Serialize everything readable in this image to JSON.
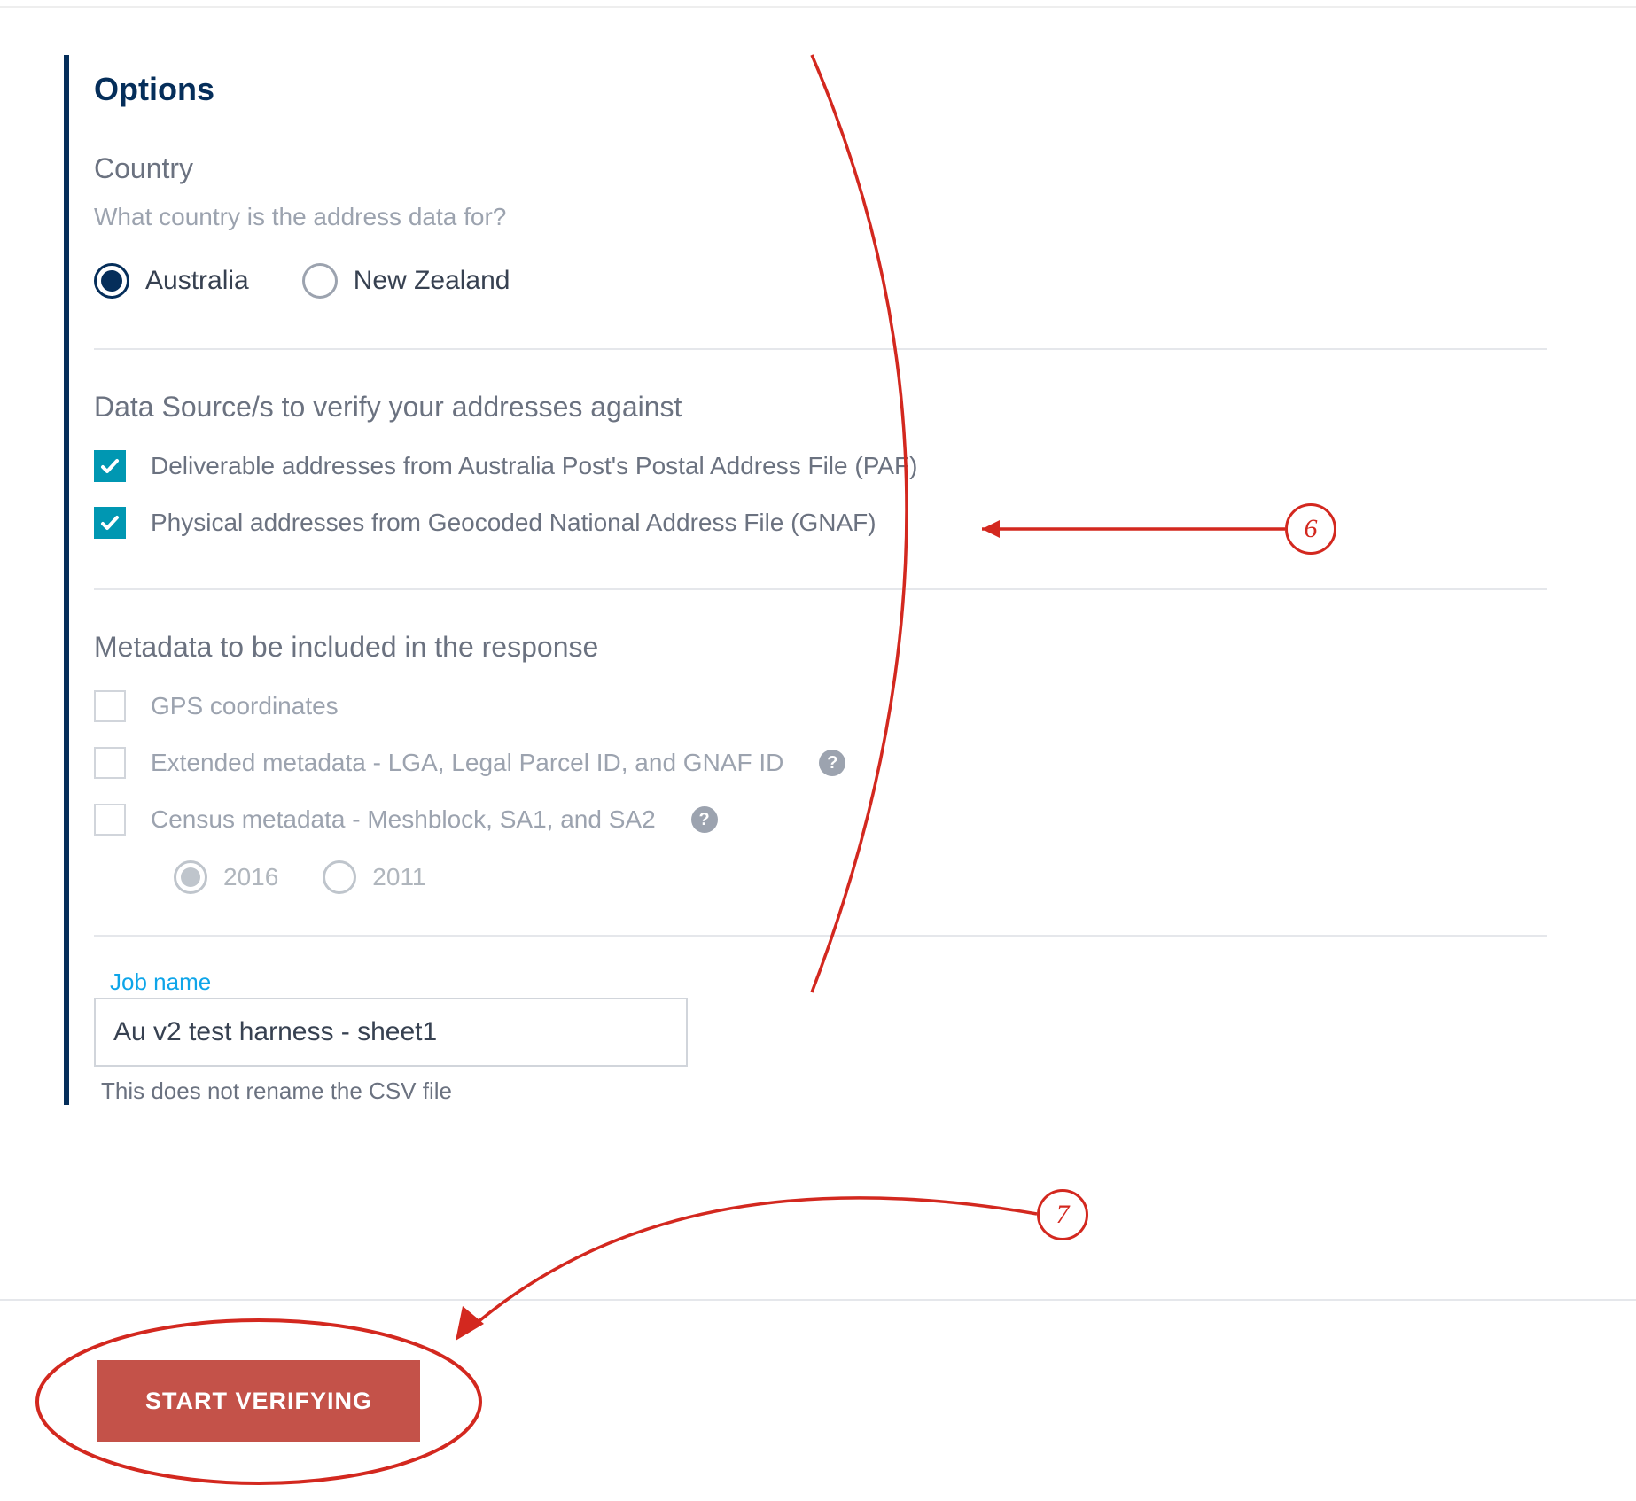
{
  "options": {
    "title": "Options",
    "country": {
      "heading": "Country",
      "helper": "What country is the address data for?",
      "choices": {
        "au": "Australia",
        "nz": "New Zealand"
      }
    },
    "sources": {
      "heading": "Data Source/s to verify your addresses against",
      "paf": "Deliverable addresses from Australia Post's Postal Address File (PAF)",
      "gnaf": "Physical addresses from Geocoded National Address File (GNAF)"
    },
    "metadata": {
      "heading": "Metadata to be included in the response",
      "gps": "GPS coordinates",
      "extended": "Extended metadata - LGA, Legal Parcel ID, and GNAF ID",
      "census": "Census metadata - Meshblock, SA1, and SA2",
      "years": {
        "y2016": "2016",
        "y2011": "2011"
      }
    },
    "jobname": {
      "label": "Job name",
      "value": "Au v2 test harness - sheet1",
      "note": "This does not rename the CSV file"
    }
  },
  "actions": {
    "start": "START VERIFYING"
  },
  "annotations": {
    "six": "6",
    "seven": "7"
  }
}
